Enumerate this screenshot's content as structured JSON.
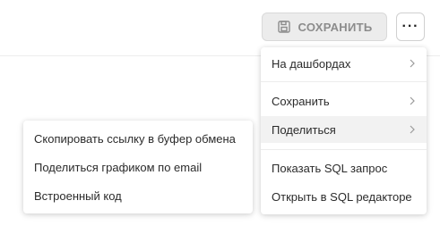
{
  "toolbar": {
    "save_label": "СОХРАНИТЬ",
    "save_icon": "floppy-disk-icon",
    "more_label": "···",
    "more_icon": "more-horizontal-icon"
  },
  "main_menu": {
    "items": [
      {
        "label": "На дашбордах",
        "has_submenu": true
      },
      {
        "label": "Сохранить",
        "has_submenu": true
      },
      {
        "label": "Поделиться",
        "has_submenu": true,
        "active": true
      },
      {
        "label": "Показать SQL запрос",
        "has_submenu": false
      },
      {
        "label": "Открыть в SQL редакторе",
        "has_submenu": false
      }
    ]
  },
  "share_submenu": {
    "items": [
      {
        "label": "Скопировать ссылку в буфер обмена"
      },
      {
        "label": "Поделиться графиком по email"
      },
      {
        "label": "Встроенный код"
      }
    ]
  },
  "colors": {
    "save_button_bg": "#ececec",
    "save_button_text": "#8c8c8c",
    "active_item_bg": "#f2f2f2",
    "text": "#2b2b2b"
  }
}
